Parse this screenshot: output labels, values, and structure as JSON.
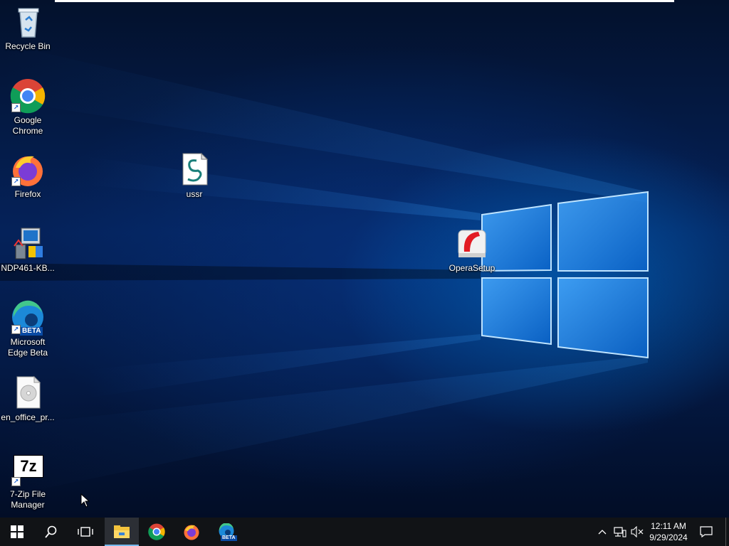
{
  "desktop": {
    "icons": [
      {
        "label": "Recycle Bin",
        "icon": "recycle-bin-icon"
      },
      {
        "label": "Google Chrome",
        "icon": "chrome-icon"
      },
      {
        "label": "Firefox",
        "icon": "firefox-icon"
      },
      {
        "label": "NDP461-KB...",
        "icon": "installer-icon"
      },
      {
        "label": "Microsoft Edge Beta",
        "icon": "edge-beta-icon"
      },
      {
        "label": "en_office_pr...",
        "icon": "disc-image-icon"
      },
      {
        "label": "7-Zip File Manager",
        "icon": "7zip-icon"
      },
      {
        "label": "ussr",
        "icon": "script-file-icon"
      },
      {
        "label": "OperaSetup",
        "icon": "opera-setup-icon"
      }
    ],
    "edge_badge": "BETA",
    "sevenzip_glyph": "7z"
  },
  "taskbar": {
    "buttons": [
      {
        "name": "start",
        "icon": "windows-logo-icon"
      },
      {
        "name": "search",
        "icon": "search-icon"
      },
      {
        "name": "task-view",
        "icon": "task-view-icon"
      },
      {
        "name": "file-explorer",
        "icon": "folder-icon",
        "active": true
      },
      {
        "name": "chrome",
        "icon": "chrome-icon"
      },
      {
        "name": "firefox",
        "icon": "firefox-icon"
      },
      {
        "name": "edge-beta",
        "icon": "edge-beta-icon"
      }
    ],
    "edge_badge": "BETA",
    "tray": {
      "icons": [
        "chevron-up-icon",
        "network-icon",
        "volume-muted-icon"
      ],
      "time": "12:11 AM",
      "date": "9/29/2024",
      "notifications_icon": "action-center-icon"
    }
  },
  "colors": {
    "taskbar": "#111316",
    "accent": "#0078d7",
    "active_indicator": "#76b9ed"
  }
}
